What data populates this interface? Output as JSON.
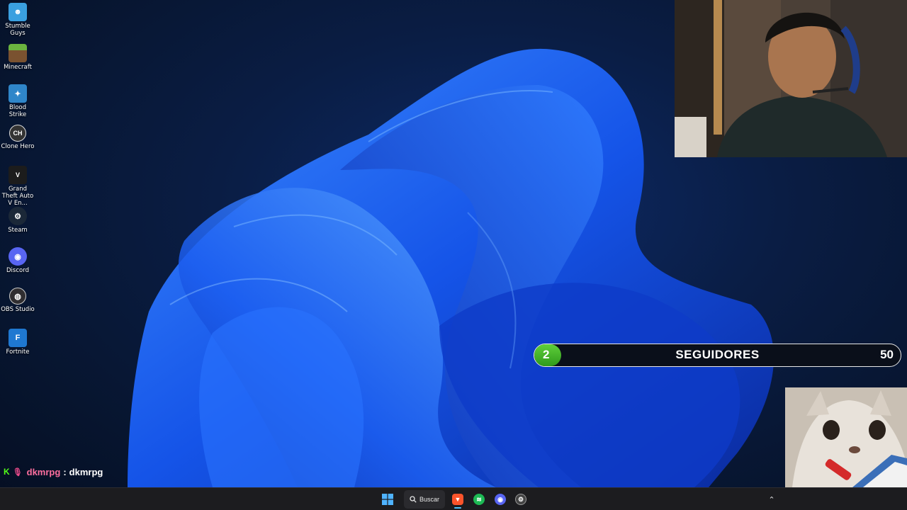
{
  "desktop": {
    "icons": [
      {
        "label": "Stumble Guys",
        "icon": "stumble-guys-icon",
        "color": "#3aa0e0"
      },
      {
        "label": "Minecraft",
        "icon": "minecraft-icon",
        "color": "#5a8f3a"
      },
      {
        "label": "Blood Strike",
        "icon": "blood-strike-icon",
        "color": "#2f86c9"
      },
      {
        "label": "Clone Hero",
        "icon": "clone-hero-icon",
        "color": "#333333"
      },
      {
        "label": "Grand Theft Auto V En...",
        "icon": "gta-v-icon",
        "color": "#1c1c1c"
      },
      {
        "label": "Steam",
        "icon": "steam-icon",
        "color": "#1b2838"
      },
      {
        "label": "Discord",
        "icon": "discord-icon",
        "color": "#5865f2"
      },
      {
        "label": "OBS Studio",
        "icon": "obs-studio-icon",
        "color": "#302e31"
      },
      {
        "label": "Fortnite",
        "icon": "fortnite-icon",
        "color": "#1f78d1"
      }
    ]
  },
  "goal": {
    "current": "2",
    "label": "SEGUIDORES",
    "target": "50",
    "progress_fraction": 0.04,
    "fill_color": "#4cc22a"
  },
  "chat": {
    "username": "dkmrpg",
    "separator": ":",
    "message": "dkmrpg"
  },
  "taskbar": {
    "search_label": "Buscar",
    "apps": [
      {
        "name": "brave-browser-icon",
        "color": "#fb542b",
        "active": true
      },
      {
        "name": "spotify-icon",
        "color": "#1db954",
        "active": false
      },
      {
        "name": "discord-icon",
        "color": "#5865f2",
        "active": false
      },
      {
        "name": "settings-icon",
        "color": "#444444",
        "active": false
      }
    ]
  }
}
